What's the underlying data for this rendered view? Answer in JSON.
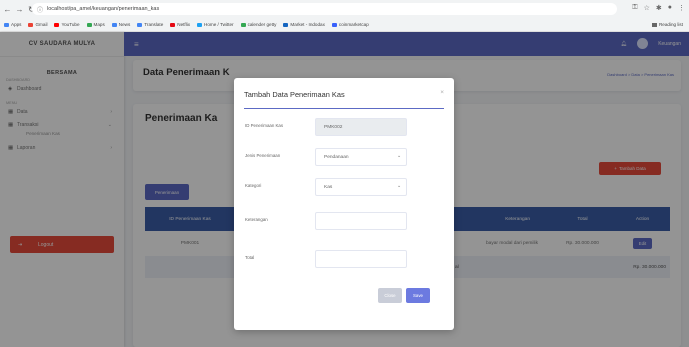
{
  "browser": {
    "url": "localhost/pa_amel/keuangan/penerimaan_kas",
    "bookmarks": [
      "Apps",
      "Gmail",
      "YouTube",
      "Maps",
      "News",
      "Translate",
      "Netflix",
      "Home / Twitter",
      "calender getty",
      "Market - Indodax",
      "coinmarketcap"
    ],
    "reading_list": "Reading list"
  },
  "sidebar": {
    "brand": "CV SAUDARA MULYA",
    "subtitle": "BERSAMA",
    "section_dashboard": "DASHBOARD",
    "dashboard": "Dashboard",
    "section_menu": "MENU",
    "items": [
      "Data",
      "Transaksi",
      "Laporan"
    ],
    "sub_item": "Penerimaan Kas",
    "logout": "Logout"
  },
  "topbar": {
    "user": "Keuangan"
  },
  "page": {
    "title": "Data Penerimaan K",
    "breadcrumb": "Dashboard > Data > Penerimaan Kas",
    "heading": "Penerimaan Ka",
    "add_button": "Tambah Data",
    "tab": "Penerimaan"
  },
  "table": {
    "headers": [
      "ID Penerimaan Kas",
      "Keterangan",
      "Total",
      "Action"
    ],
    "rows": [
      {
        "id": "PMK001",
        "ket": "bayar modal dari pemilik",
        "total": "Rp. 30.000.000",
        "action": "Edit"
      }
    ],
    "total_row": {
      "label": "al",
      "value": "Rp. 30.000.000"
    }
  },
  "modal": {
    "title": "Tambah Data Penerimaan Kas",
    "close_icon": "×",
    "fields": [
      {
        "label": "ID Penerimaan Kas",
        "value": "PMK002"
      },
      {
        "label": "Jenis Penerimaan",
        "value": "Pendanaan"
      },
      {
        "label": "Kategori",
        "value": "Kas"
      },
      {
        "label": "Keterangan",
        "value": ""
      },
      {
        "label": "Total",
        "value": ""
      }
    ],
    "btn_close": "Close",
    "btn_save": "Save"
  }
}
